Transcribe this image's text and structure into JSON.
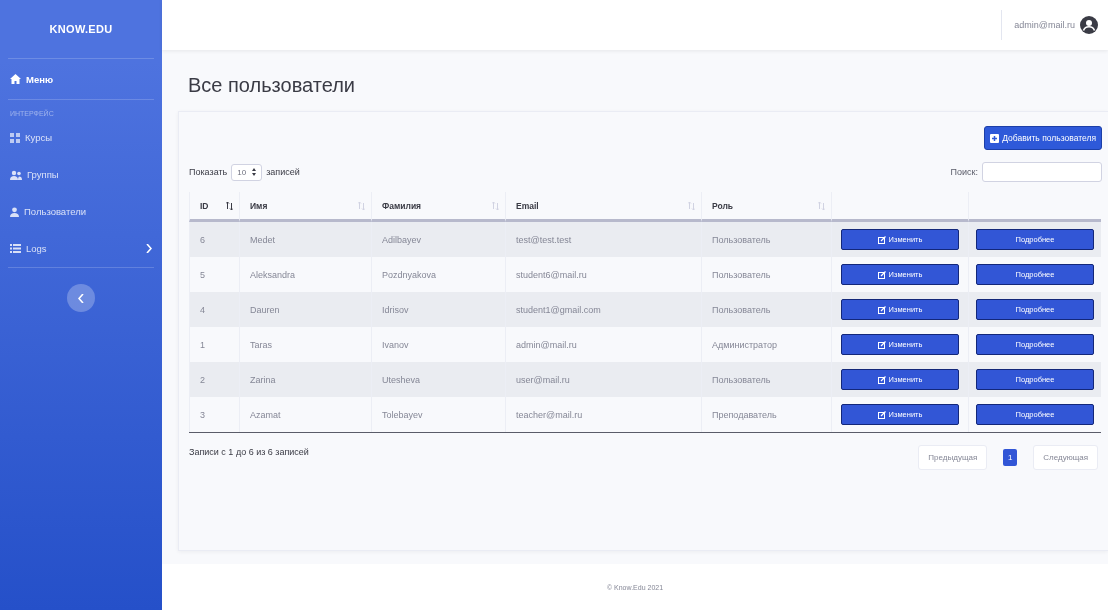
{
  "sidebar": {
    "brand": "KNOW.EDU",
    "items": [
      {
        "label": "Меню",
        "kind": "link",
        "selected": true
      },
      {
        "label": "ИНТЕРФЕЙС",
        "kind": "heading"
      },
      {
        "label": "Курсы",
        "kind": "link",
        "selected": false
      },
      {
        "label": "Группы",
        "kind": "link",
        "selected": false
      },
      {
        "label": "Пользователи",
        "kind": "link",
        "selected": false
      },
      {
        "label": "Logs",
        "kind": "submenu",
        "selected": false,
        "expanded": false
      }
    ]
  },
  "topbar": {
    "user": "admin@mail.ru"
  },
  "page_title": "Все пользователи",
  "add_button": "Добавить пользователя",
  "length_control": {
    "prefix": "Показать",
    "value": "10",
    "suffix": "записей"
  },
  "search": {
    "label": "Поиск:"
  },
  "table": {
    "columns": [
      {
        "label": "ID",
        "sorted": true
      },
      {
        "label": "Имя",
        "sorted": false
      },
      {
        "label": "Фамилия",
        "sorted": false
      },
      {
        "label": "Email",
        "sorted": false
      },
      {
        "label": "Роль",
        "sorted": false
      }
    ],
    "rows": [
      {
        "cells": [
          "6",
          "Medet",
          "Adilbayev",
          "test@test.test",
          "Пользователь"
        ],
        "edit": "Изменить",
        "details": "Подробнее"
      },
      {
        "cells": [
          "5",
          "Aleksandra",
          "Pozdnyakova",
          "student6@mail.ru",
          "Пользователь"
        ],
        "edit": "Изменить",
        "details": "Подробнее"
      },
      {
        "cells": [
          "4",
          "Dauren",
          "Idrisov",
          "student1@gmail.com",
          "Пользователь"
        ],
        "edit": "Изменить",
        "details": "Подробнее"
      },
      {
        "cells": [
          "1",
          "Taras",
          "Ivanov",
          "admin@mail.ru",
          "Администратор"
        ],
        "edit": "Изменить",
        "details": "Подробнее"
      },
      {
        "cells": [
          "2",
          "Zarina",
          "Utesheva",
          "user@mail.ru",
          "Пользователь"
        ],
        "edit": "Изменить",
        "details": "Подробнее"
      },
      {
        "cells": [
          "3",
          "Azamat",
          "Tolebayev",
          "teacher@mail.ru",
          "Преподаватель"
        ],
        "edit": "Изменить",
        "details": "Подробнее"
      }
    ]
  },
  "info": "Записи с 1 до 6 из 6 записей",
  "pagination": {
    "previous": "Предыдущая",
    "pages": [
      {
        "label": "1",
        "selected": true
      }
    ],
    "next": "Следующая"
  },
  "footer": "© Know.Edu 2021"
}
